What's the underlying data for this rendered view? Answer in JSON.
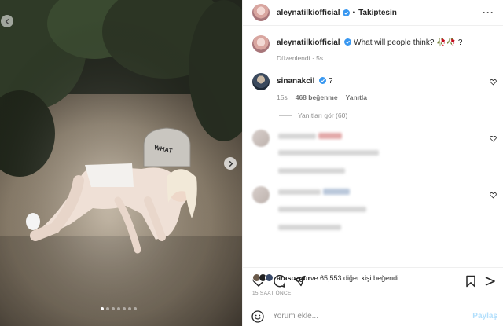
{
  "photo": {
    "sign_text": "WHAT",
    "carousel": {
      "count": 7,
      "active": 0
    },
    "icons": {
      "back": "arrow-left-icon",
      "next": "chevron-right-icon"
    }
  },
  "header": {
    "username": "aleynatilkiofficial",
    "separator": "•",
    "follow_label": "Takiptesin",
    "more": "···"
  },
  "caption": {
    "username": "aleynatilkiofficial",
    "text": "What will people think? 🥀🥀 ?",
    "edited": "Düzenlendi · 5s"
  },
  "comments": [
    {
      "username": "sinanakcil",
      "text": "?",
      "time": "15s",
      "likes": "468 beğenme",
      "reply": "Yanıtla",
      "view_replies": "Yanıtları gör (60)"
    }
  ],
  "footer": {
    "liked_by_user": "arasozgur",
    "liked_by_rest": " ve 65,553 diğer kişi beğendi",
    "timestamp": "15 SAAT ÖNCE",
    "comment_placeholder": "Yorum ekle...",
    "post_label": "Paylaş"
  },
  "colors": {
    "verified": "#3897f0",
    "post_disabled": "#b2dffc",
    "muted": "#8e8e8e"
  }
}
